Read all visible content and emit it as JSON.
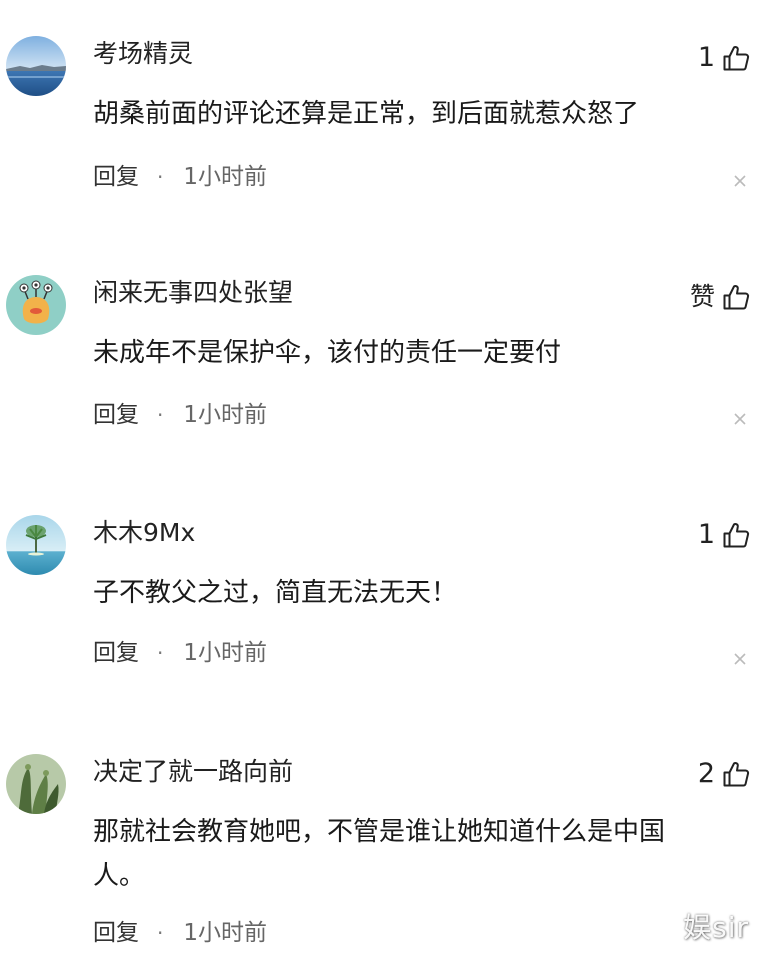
{
  "comments": [
    {
      "username": "考场精灵",
      "content": "胡桑前面的评论还算是正常，到后面就惹众怒了",
      "like_count": "1",
      "reply_label": "回复",
      "separator": "·",
      "time": "1小时前",
      "avatar_icon": "avatar-lake-icon"
    },
    {
      "username": "闲来无事四处张望",
      "content": "未成年不是保护伞，该付的责任一定要付",
      "like_count": "赞",
      "reply_label": "回复",
      "separator": "·",
      "time": "1小时前",
      "avatar_icon": "avatar-monster-icon"
    },
    {
      "username": "木木9Mx",
      "content": "子不教父之过，简直无法无天！",
      "like_count": "1",
      "reply_label": "回复",
      "separator": "·",
      "time": "1小时前",
      "avatar_icon": "avatar-tree-icon"
    },
    {
      "username": "决定了就一路向前",
      "content": "那就社会教育她吧，不管是谁让她知道什么是中国人。",
      "like_count": "2",
      "reply_label": "回复",
      "separator": "·",
      "time": "1小时前",
      "avatar_icon": "avatar-plant-icon"
    }
  ],
  "watermark": "娱sir",
  "colors": {
    "text": "#222222",
    "meta": "#666666",
    "close": "#bbbbbb",
    "background": "#ffffff"
  }
}
